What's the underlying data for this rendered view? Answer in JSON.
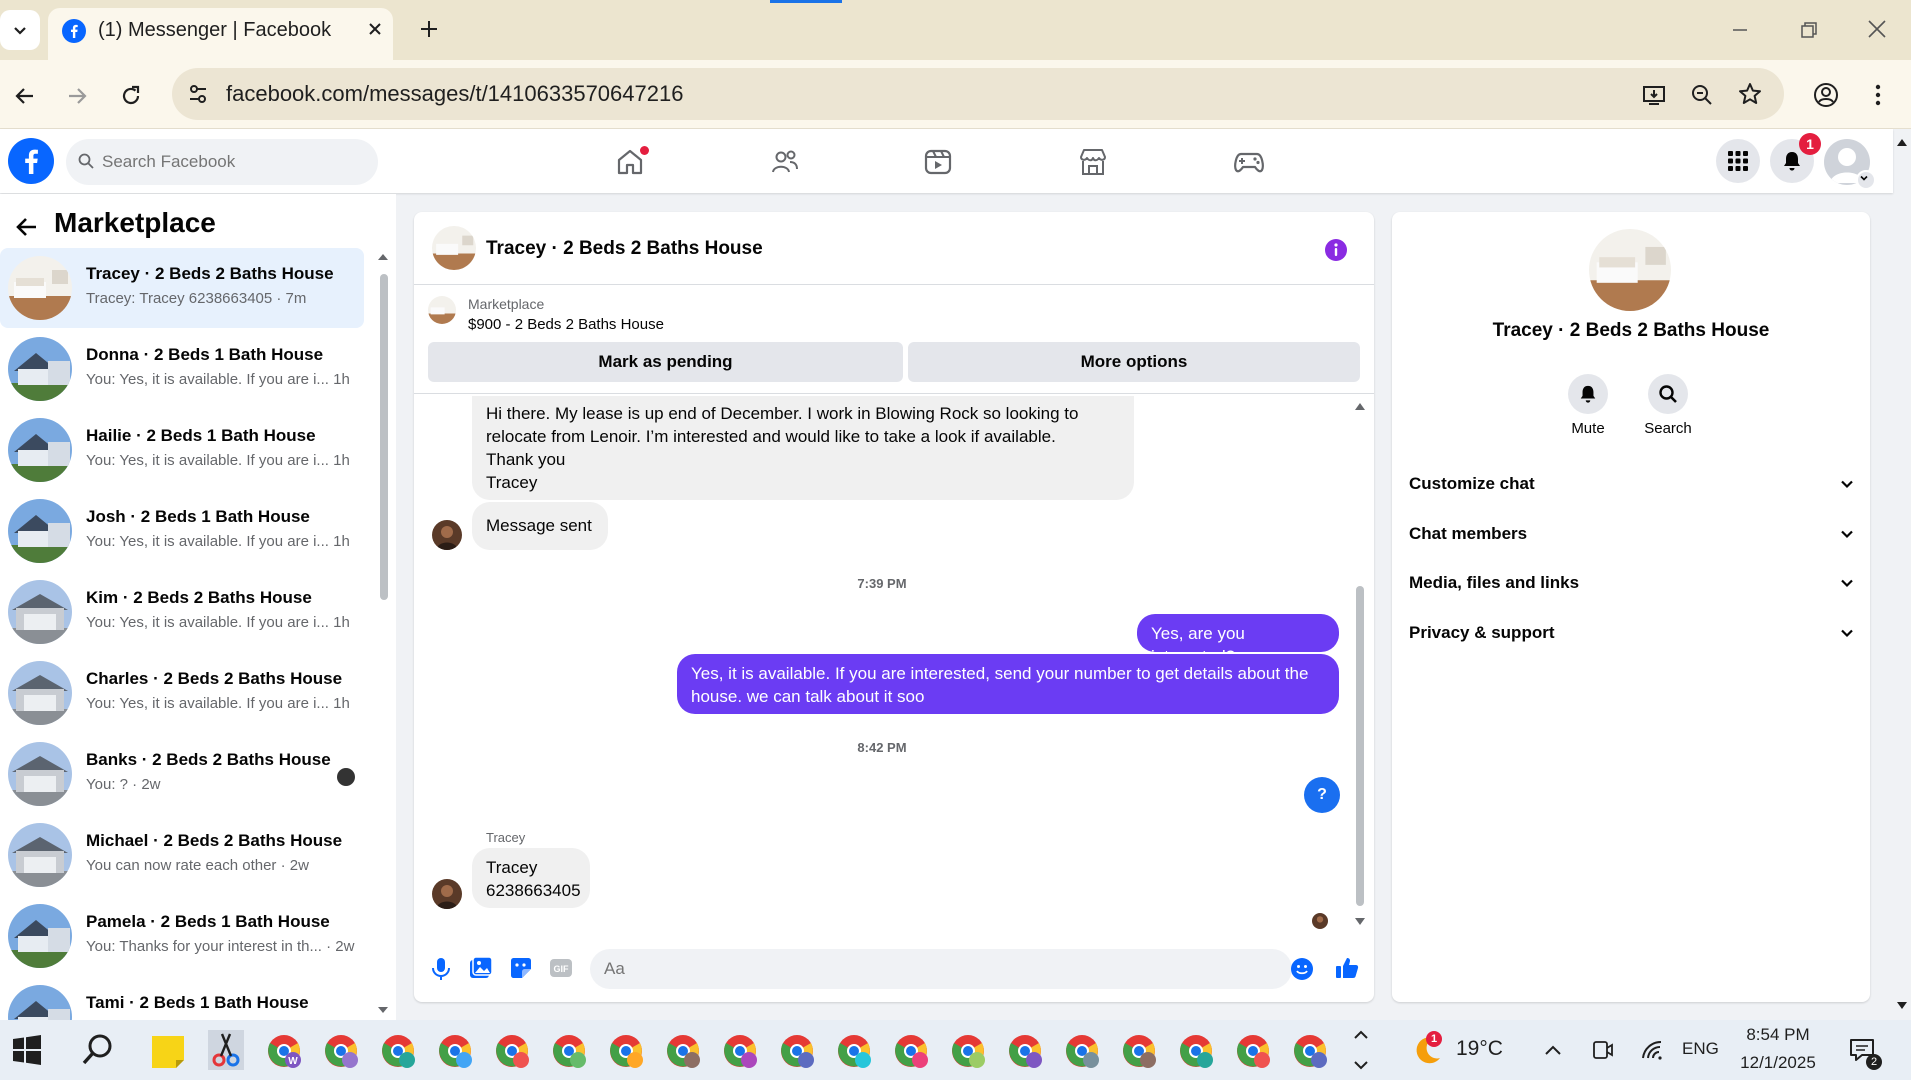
{
  "browser": {
    "tab_title": "(1) Messenger | Facebook",
    "url": "facebook.com/messages/t/1410633570647216"
  },
  "facebook": {
    "search_placeholder": "Search Facebook",
    "notification_count": "1",
    "nav_icons": [
      "home-icon",
      "friends-icon",
      "video-icon",
      "marketplace-icon",
      "gaming-icon"
    ]
  },
  "sidebar": {
    "title": "Marketplace",
    "conversations": [
      {
        "name": "Tracey · 2 Beds 2 Baths House",
        "preview": "Tracey: Tracey 6238663405 · 7m"
      },
      {
        "name": "Donna · 2 Beds 1 Bath House",
        "preview": "You: Yes, it is available. If you are i...   1h"
      },
      {
        "name": "Hailie · 2 Beds 1 Bath House",
        "preview": "You: Yes, it is available. If you are i...   1h"
      },
      {
        "name": "Josh · 2 Beds 1 Bath House",
        "preview": "You: Yes, it is available. If you are i...   1h"
      },
      {
        "name": "Kim · 2 Beds 2 Baths House",
        "preview": "You: Yes, it is available. If you are i...   1h"
      },
      {
        "name": "Charles · 2 Beds 2 Baths House",
        "preview": "You: Yes, it is available. If you are i...   1h"
      },
      {
        "name": "Banks · 2 Beds 2 Baths House",
        "preview": "You: ? · 2w"
      },
      {
        "name": "Michael · 2 Beds 2 Baths House",
        "preview": "You can now rate each other · 2w"
      },
      {
        "name": "Pamela · 2 Beds 1 Bath House",
        "preview": "You: Thanks for your interest in th...  · 2w"
      },
      {
        "name": "Tami · 2 Beds 1 Bath House",
        "preview": ""
      }
    ]
  },
  "chat": {
    "title": "Tracey · 2 Beds 2 Baths House",
    "listing_source": "Marketplace",
    "listing_price": "$900 - 2 Beds 2 Baths House",
    "mark_pending_label": "Mark as pending",
    "more_options_label": "More options",
    "messages": {
      "m1_lines": [
        "Hi there. My lease is up end of December. I work in Blowing Rock so looking to",
        "relocate from Lenoir. I’m interested and would like to take a look if available.",
        "Thank you",
        "Tracey"
      ],
      "m2": "Message sent",
      "ts1": "7:39 PM",
      "m3": "Yes, are you interested?",
      "m4_lines": [
        "Yes, it is available. If you are interested, send your number to get details about the",
        "house. we can talk about it soo"
      ],
      "ts2": "8:42 PM",
      "m5": "?",
      "sender": "Tracey",
      "m6_lines": [
        "Tracey",
        "6238663405"
      ]
    },
    "composer_placeholder": "Aa"
  },
  "details": {
    "name": "Tracey · 2 Beds 2 Baths House",
    "mute_label": "Mute",
    "search_label": "Search",
    "sections": [
      "Customize chat",
      "Chat members",
      "Media, files and links",
      "Privacy & support"
    ]
  },
  "taskbar": {
    "temperature": "19°C",
    "weather_badge": "1",
    "language": "ENG",
    "time": "8:54 PM",
    "date": "12/1/2025",
    "notification_count": "2"
  },
  "colors": {
    "fb_blue": "#0866ff",
    "messenger_purple": "#6b3cf3",
    "badge_red": "#e41e3f"
  }
}
